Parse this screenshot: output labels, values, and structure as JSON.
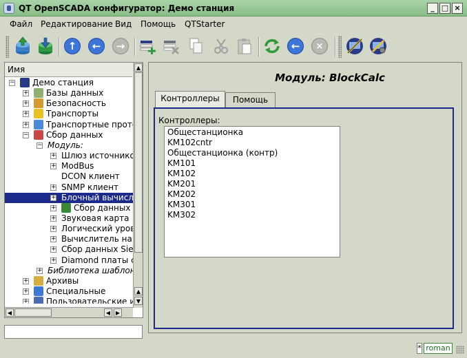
{
  "window": {
    "title": "QT OpenSCADA конфигуратор: Демо станция",
    "minimize_label": "_",
    "maximize_label": "□",
    "close_label": "×"
  },
  "menu": {
    "items": [
      {
        "label": "Файл"
      },
      {
        "label": "Редактирование"
      },
      {
        "label": "Вид"
      },
      {
        "label": "Помощь"
      },
      {
        "label": "QTStarter"
      }
    ]
  },
  "toolbar": {
    "buttons": [
      {
        "icon": "db-load-icon"
      },
      {
        "icon": "db-save-icon"
      },
      {
        "icon": "up-icon"
      },
      {
        "icon": "back-icon"
      },
      {
        "icon": "forward-icon"
      },
      {
        "icon": "add-item-icon"
      },
      {
        "icon": "delete-item-icon"
      },
      {
        "icon": "copy-icon"
      },
      {
        "icon": "cut-icon"
      },
      {
        "icon": "paste-icon"
      },
      {
        "icon": "refresh-icon"
      },
      {
        "icon": "start-icon"
      },
      {
        "icon": "stop-icon"
      },
      {
        "icon": "station-icon"
      },
      {
        "icon": "config-icon"
      }
    ]
  },
  "tree": {
    "header": "Имя",
    "rows": [
      {
        "label": "Демо станция",
        "level": 0,
        "expander": "−",
        "icon": "station-icon",
        "italic": false
      },
      {
        "label": "Базы данных",
        "level": 1,
        "expander": "+",
        "icon": "database-icon",
        "italic": false
      },
      {
        "label": "Безопасность",
        "level": 1,
        "expander": "+",
        "icon": "security-icon",
        "italic": false
      },
      {
        "label": "Транспорты",
        "level": 1,
        "expander": "+",
        "icon": "transport-icon",
        "italic": false
      },
      {
        "label": "Транспортные прото",
        "level": 1,
        "expander": "+",
        "icon": "protocol-icon",
        "italic": false
      },
      {
        "label": "Сбор данных",
        "level": 1,
        "expander": "−",
        "icon": "daq-icon",
        "italic": false
      },
      {
        "label": "Модуль:",
        "level": 2,
        "expander": "−",
        "icon": "",
        "italic": true
      },
      {
        "label": "Шлюз источников",
        "level": 3,
        "expander": "+",
        "icon": "",
        "italic": false
      },
      {
        "label": "ModBus",
        "level": 3,
        "expander": "+",
        "icon": "",
        "italic": false
      },
      {
        "label": "DCON клиент",
        "level": 3,
        "expander": "",
        "icon": "",
        "italic": false
      },
      {
        "label": "SNMP клиент",
        "level": 3,
        "expander": "+",
        "icon": "",
        "italic": false
      },
      {
        "label": "Блочный вычисл",
        "level": 3,
        "expander": "+",
        "icon": "",
        "italic": false,
        "selected": true
      },
      {
        "label": "Сбор данных",
        "level": 3,
        "expander": "+",
        "icon": "daq-module-icon",
        "italic": false
      },
      {
        "label": "Звуковая карта",
        "level": 3,
        "expander": "+",
        "icon": "",
        "italic": false
      },
      {
        "label": "Логический уров",
        "level": 3,
        "expander": "+",
        "icon": "",
        "italic": false
      },
      {
        "label": "Вычислитель на",
        "level": 3,
        "expander": "+",
        "icon": "",
        "italic": false
      },
      {
        "label": "Сбор данных Sie",
        "level": 3,
        "expander": "+",
        "icon": "",
        "italic": false
      },
      {
        "label": "Diamond платы с",
        "level": 3,
        "expander": "+",
        "icon": "",
        "italic": false
      },
      {
        "label": "Библиотека шаблон",
        "level": 2,
        "expander": "+",
        "icon": "",
        "italic": true
      },
      {
        "label": "Архивы",
        "level": 1,
        "expander": "+",
        "icon": "archive-icon",
        "italic": false
      },
      {
        "label": "Специальные",
        "level": 1,
        "expander": "+",
        "icon": "special-icon",
        "italic": false
      },
      {
        "label": "Пользовательские и",
        "level": 1,
        "expander": "+",
        "icon": "ui-icon",
        "italic": false
      }
    ]
  },
  "module": {
    "title": "Модуль: BlockCalc"
  },
  "tabs": [
    {
      "label": "Контроллеры",
      "active": true
    },
    {
      "label": "Помощь",
      "active": false
    }
  ],
  "controllers": {
    "label": "Контроллеры:",
    "items": [
      "Общестанционка",
      "KM102cntr",
      "Общестанционка (контр)",
      "KM101",
      "KM102",
      "KM201",
      "KM202",
      "KM301",
      "KM302"
    ]
  },
  "status": {
    "modified_marker": "*",
    "user": "roman"
  },
  "colors": {
    "titlebar": "#9ccb9c",
    "selection": "#1c2a8c",
    "window_bg": "#d4d8c8"
  }
}
